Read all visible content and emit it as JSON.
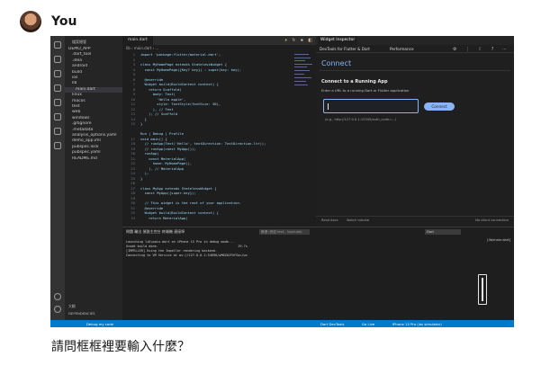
{
  "chat": {
    "user_name": "You",
    "question": "請問框框裡要輸入什麼？"
  },
  "colors": {
    "accent_blue": "#007acc",
    "devtools_accent": "#8ab4f8",
    "editor_bg": "#1e1e1e"
  },
  "explorer": {
    "title": "檔案總管",
    "items": [
      "DEMO_APP",
      ".dart_tool",
      ".idea",
      "android",
      "build",
      "ios",
      "lib",
      "main.dart",
      "linux",
      "macos",
      "test",
      "web",
      "windows",
      ".gitignore",
      ".metadata",
      "analysis_options.yaml",
      "demo_app.iml",
      "pubspec.lock",
      "pubspec.yaml",
      "README.md"
    ],
    "bottom": [
      "大綱",
      "DEPENDENCIES"
    ]
  },
  "editor": {
    "tab_label": "main.dart",
    "breadcrumb": "lib › main.dart › ...",
    "lines": [
      {
        "n": "1",
        "t": "import 'package:flutter/material.dart';"
      },
      {
        "n": "2",
        "t": ""
      },
      {
        "n": "3",
        "t": "class MyHomePage extends StatelessWidget {"
      },
      {
        "n": "4",
        "t": "  const MyHomePage({Key? key}) : super(key: key);"
      },
      {
        "n": "5",
        "t": ""
      },
      {
        "n": "6",
        "t": "  @override"
      },
      {
        "n": "7",
        "t": "  Widget build(BuildContext context) {"
      },
      {
        "n": "8",
        "t": "    return Scaffold("
      },
      {
        "n": "9",
        "t": "      body: Text("
      },
      {
        "n": "10",
        "t": "        'Hello apple',"
      },
      {
        "n": "11",
        "t": "        style: TextStyle(fontSize: 30),"
      },
      {
        "n": "12",
        "t": "      ), // Text"
      },
      {
        "n": "13",
        "t": "    ); // Scaffold"
      },
      {
        "n": "14",
        "t": "  }"
      },
      {
        "n": "15",
        "t": "}"
      },
      {
        "n": "",
        "t": ""
      },
      {
        "n": "",
        "t": "Run | Debug | Profile"
      },
      {
        "n": "17",
        "t": "void main() {"
      },
      {
        "n": "18",
        "t": "  // runApp(Text('Hello', textDirection: TextDirection.ltr));"
      },
      {
        "n": "19",
        "t": "  // runApp(const MyApp());"
      },
      {
        "n": "20",
        "t": "  runApp("
      },
      {
        "n": "21",
        "t": "    const MaterialApp("
      },
      {
        "n": "22",
        "t": "      home: MyHomePage(),"
      },
      {
        "n": "23",
        "t": "    ), // MaterialApp"
      },
      {
        "n": "24",
        "t": "  );"
      },
      {
        "n": "25",
        "t": "}"
      },
      {
        "n": "26",
        "t": ""
      },
      {
        "n": "27",
        "t": "class MyApp extends StatelessWidget {"
      },
      {
        "n": "28",
        "t": "  const MyApp({super.key});"
      },
      {
        "n": "29",
        "t": ""
      },
      {
        "n": "30",
        "t": "  // This widget is the root of your application."
      },
      {
        "n": "31",
        "t": "  @override"
      },
      {
        "n": "32",
        "t": "  Widget build(BuildContext context) {"
      },
      {
        "n": "33",
        "t": "    return MaterialApp("
      }
    ]
  },
  "devtools": {
    "tab_label": "Widget Inspector",
    "sub_tab_1": "DevTools for Flutter & Dart",
    "sub_tab_2": "Performance",
    "heading": "Connect",
    "section_title": "Connect to a Running App",
    "description": "Enter a URL to a running Dart or Flutter application",
    "input_value": "",
    "connect_label": "Connect",
    "hint": "(e.g., http://127.0.0.1:12345/auth_code=...)",
    "footer_left_1": "Read docs",
    "footer_left_2": "Watch tutorial",
    "footer_right": "No client connection"
  },
  "panel": {
    "tabs": "問題   輸出   偵錯主控台   終端機   連接埠",
    "filter_placeholder": "篩選 (例如 text、!exclude)",
    "select_value": "Dart",
    "right_label": "[lib/main.dart]",
    "lines": [
      "Launching lib\\main.dart on iPhone 15 Pro in debug mode...",
      "Xcode build done.                                          29.7s",
      "[IMPELLER] Using the Impeller rendering backend.",
      "Connecting to VM Service at ws://127.0.0.1:54690/wM6ZbCFhFGo=/ws"
    ]
  },
  "statusbar": {
    "left": "Debug my code",
    "dart": "Dart DevTools",
    "go_live": "Go Live",
    "device": "iPhone 15 Pro (ios simulator)"
  }
}
